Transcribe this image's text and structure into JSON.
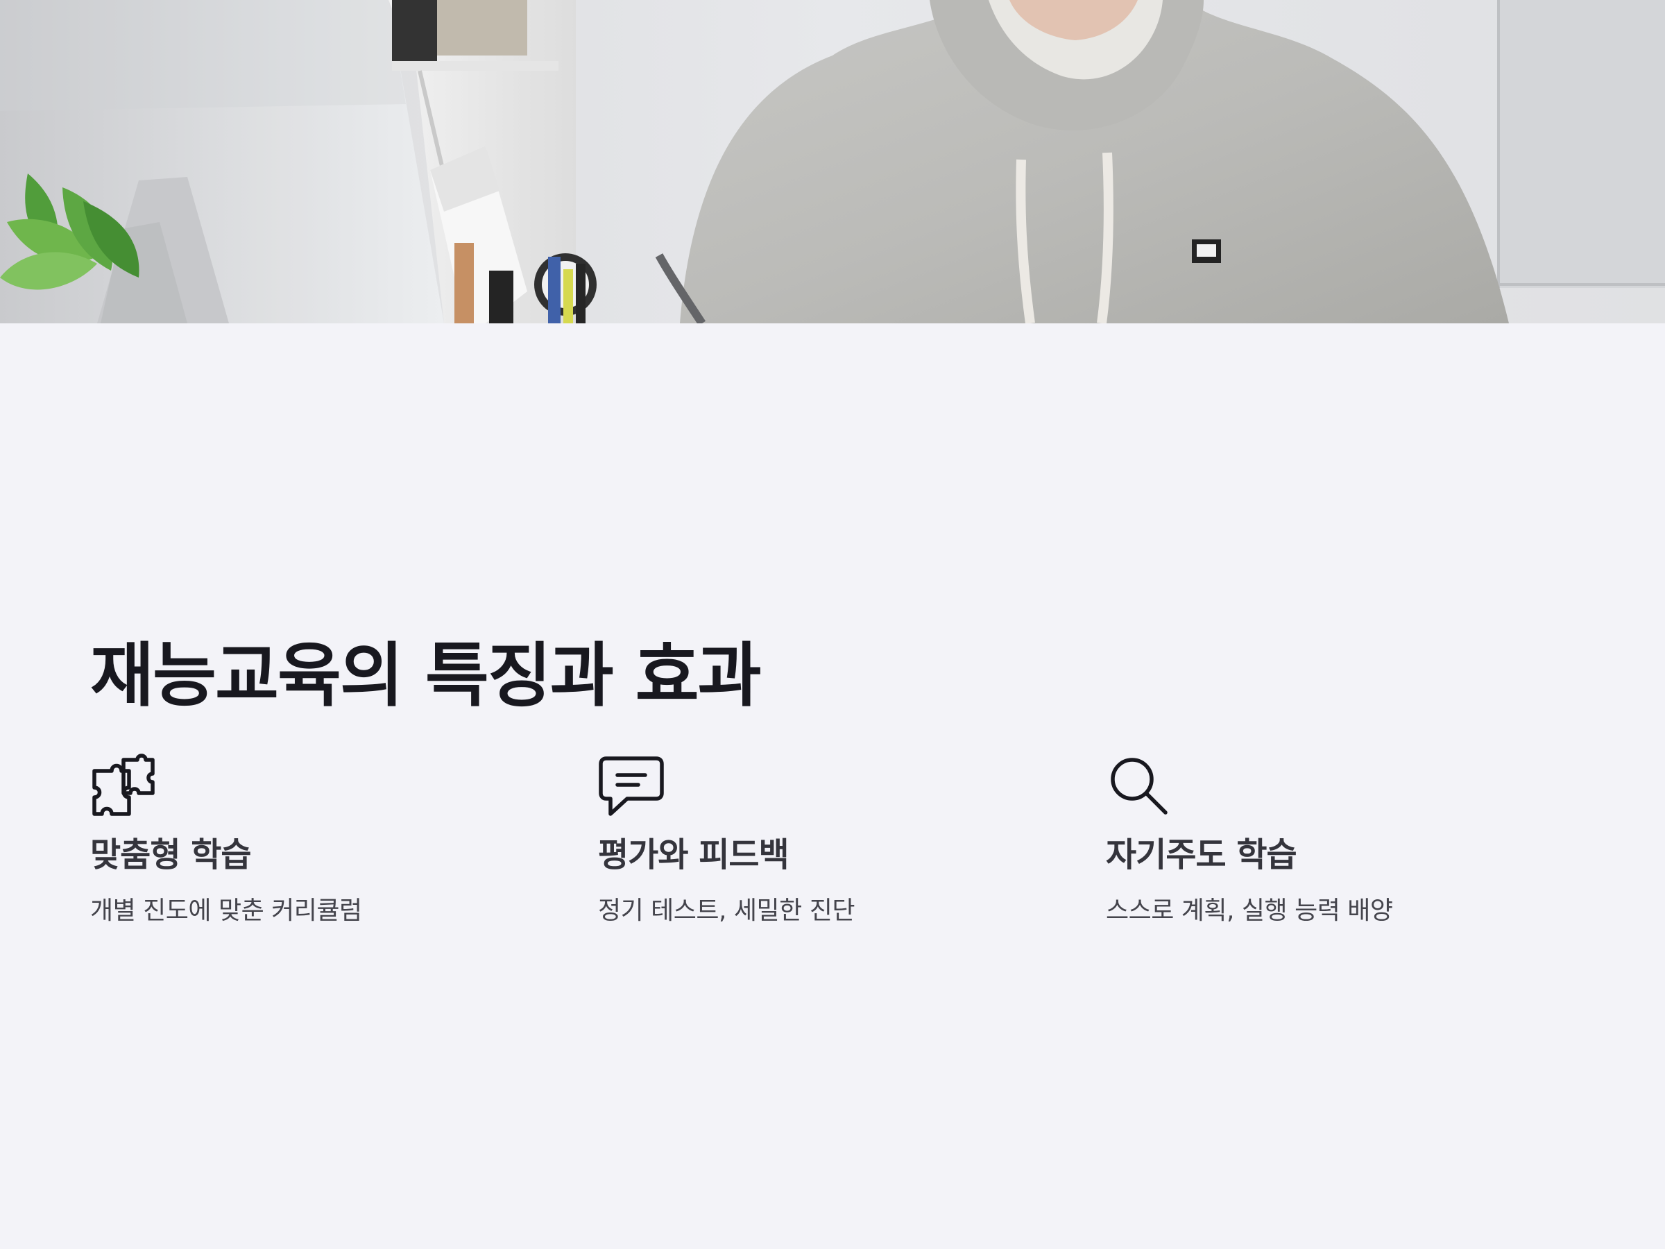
{
  "hero": {
    "alt": "Student studying at desk"
  },
  "section": {
    "title": "재능교육의 특징과 효과"
  },
  "features": [
    {
      "icon": "puzzle-icon",
      "title": "맞춤형 학습",
      "description": "개별 진도에 맞춘 커리큘럼"
    },
    {
      "icon": "chat-icon",
      "title": "평가와 피드백",
      "description": "정기 테스트, 세밀한 진단"
    },
    {
      "icon": "search-icon",
      "title": "자기주도 학습",
      "description": "스스로 계획, 실행 능력 배양"
    }
  ]
}
